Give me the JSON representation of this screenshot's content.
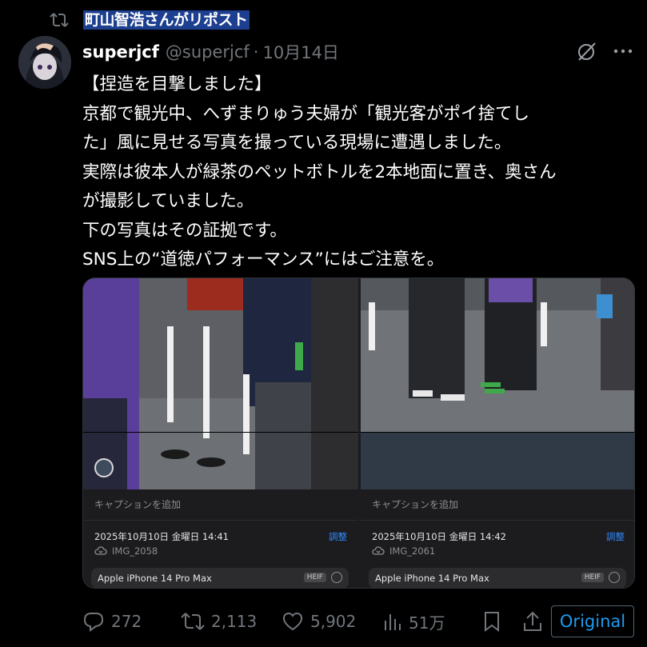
{
  "repost": {
    "text": "町山智浩さんがリポスト"
  },
  "author": {
    "display_name": "superjcf",
    "handle": "@superjcf",
    "date": "10月14日"
  },
  "tweet": {
    "lines": [
      "【捏造を目撃しました】",
      "京都で観光中、へずまりゅう夫婦が「観光客がポイ捨てし",
      "た」風に見せる写真を撮っている現場に遭遇しました。",
      "実際は彼本人が緑茶のペットボトルを2本地面に置き、奥さん",
      "が撮影していました。",
      "下の写真はその証拠です。",
      "SNS上の“道徳パフォーマンス”にはご注意を。"
    ]
  },
  "photos": [
    {
      "caption_placeholder": "キャプションを追加",
      "datetime": "2025年10月10日 金曜日 14:41",
      "adjust_label": "調整",
      "filename": "IMG_2058",
      "device": "Apple iPhone 14 Pro Max",
      "format": "HEIF"
    },
    {
      "caption_placeholder": "キャプションを追加",
      "datetime": "2025年10月10日 金曜日 14:42",
      "adjust_label": "調整",
      "filename": "IMG_2061",
      "device": "Apple iPhone 14 Pro Max",
      "format": "HEIF"
    }
  ],
  "actions": {
    "replies": "272",
    "reposts": "2,113",
    "likes": "5,902",
    "views": "51万",
    "original_label": "Original"
  },
  "icons": [
    "repost-icon",
    "grok-icon",
    "more-icon",
    "reply-icon",
    "retweet-icon",
    "like-icon",
    "views-icon",
    "bookmark-icon",
    "share-icon",
    "cloud-icon"
  ],
  "colors": {
    "background": "#000000",
    "text": "#e7e9ea",
    "muted": "#71767b",
    "accent": "#1d9bf0",
    "highlight": "#1d3f8f"
  }
}
